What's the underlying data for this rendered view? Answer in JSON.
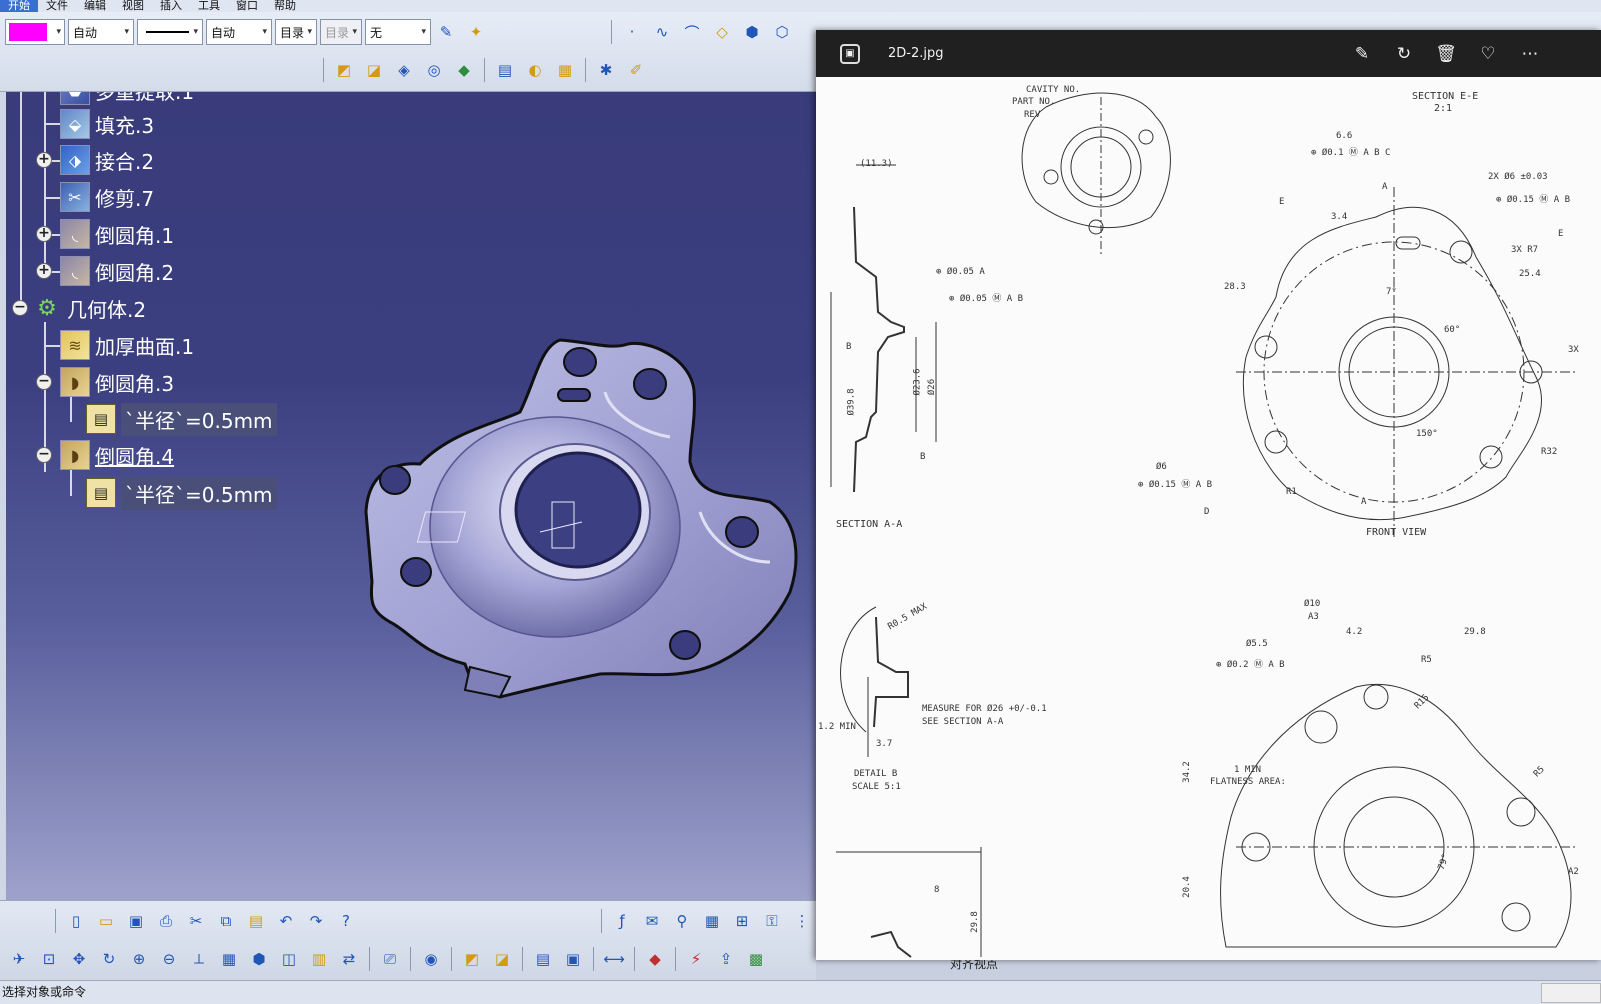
{
  "menubar": {
    "items": [
      "开始",
      "文件",
      "编辑",
      "视图",
      "插入",
      "工具",
      "窗口",
      "帮助"
    ]
  },
  "toolbar": {
    "color_value": "#ff00ff",
    "linetype_value": "自动",
    "lineweight_value": "自动",
    "layer_value": "目录",
    "layer2_value": "目录",
    "none_value": "无"
  },
  "tree": {
    "partial_top": "多重提取.1",
    "nodes": [
      {
        "label": "填充.3"
      },
      {
        "label": "接合.2"
      },
      {
        "label": "修剪.7"
      },
      {
        "label": "倒圆角.1"
      },
      {
        "label": "倒圆角.2"
      },
      {
        "label": "几何体.2"
      },
      {
        "label": "加厚曲面.1"
      },
      {
        "label": "倒圆角.3"
      },
      {
        "label": "`半径`=0.5mm"
      },
      {
        "label": "倒圆角.4"
      },
      {
        "label": "`半径`=0.5mm"
      }
    ]
  },
  "status": {
    "prompt": "选择对象或命令",
    "align_label": "对齐视点"
  },
  "viewer": {
    "filename": "2D-2.jpg"
  },
  "drawing": {
    "labels": {
      "cavity_no": "CAVITY NO.",
      "part_no": "PART NO.",
      "rev": "REV",
      "section_ee": "SECTION E-E",
      "scale_2_1": "2:1",
      "dim_66": "6.6",
      "dim_113": "(11.3)",
      "dim_34": "3.4",
      "fcf_1": "⊕ Ø0.1 Ⓜ A B C",
      "fcf_005a": "⊕ Ø0.05 A",
      "fcf_005b": "⊕ Ø0.05 Ⓜ A B",
      "fcf_015": "⊕ Ø0.15 Ⓜ A B",
      "dim_2xd6": "2X Ø6 ±0.03",
      "dim_3xr7": "3X R7",
      "dim_254": "25.4",
      "dim_283": "28.3",
      "dim_398": "Ø39.8",
      "dim_236": "Ø23.6",
      "dim_26": "Ø26",
      "angle_7": "7°",
      "angle_60": "60°",
      "angle_150": "150°",
      "r32": "R32",
      "r1": "R1",
      "b": "B",
      "e": "E",
      "a": "A",
      "d": "D",
      "c": "C",
      "3x": "3X",
      "section_aa": "SECTION A-A",
      "front_view": "FRONT VIEW",
      "d6": "Ø6",
      "fcf_015b": "⊕ Ø0.15 Ⓜ A B",
      "r05max": "R0.5 MAX",
      "measure": "MEASURE FOR  Ø26 +0/-0.1",
      "see_section": "SEE SECTION A-A",
      "min12": "1.2  MIN",
      "dim_37": "3.7",
      "detail_b": "DETAIL B",
      "scale_5_1": "SCALE 5:1",
      "d10": "Ø10",
      "a3": "A3",
      "dim_42": "4.2",
      "dim_298": "29.8",
      "dim_55": "Ø5.5",
      "fcf_02": "⊕ Ø0.2 Ⓜ A B",
      "r5": "R5",
      "r15": "R15",
      "one_min": "1 MIN",
      "flatness": "FLATNESS AREA:",
      "dim_342": "34.2",
      "dim_204": "20.4",
      "dim_8": "8",
      "dim_298b": "29.8",
      "angle_79": "79°",
      "a2": "A2",
      "r5b": "R5"
    }
  }
}
